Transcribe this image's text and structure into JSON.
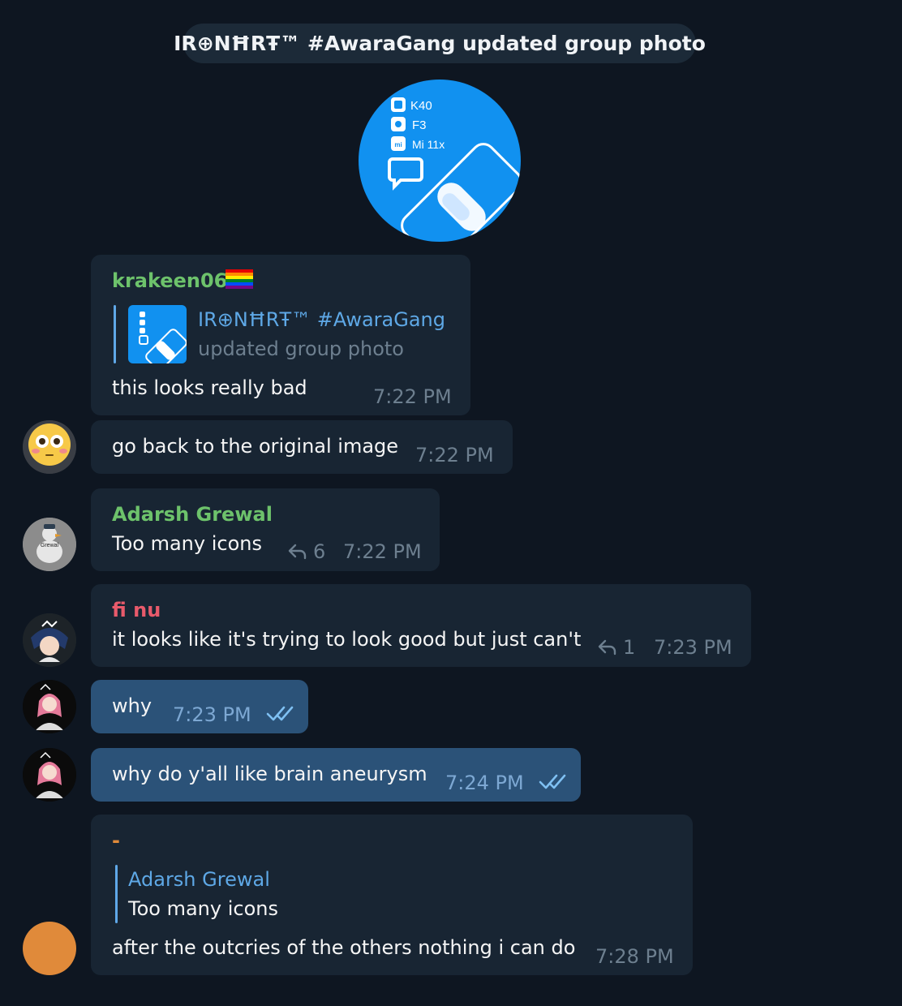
{
  "colors": {
    "background": "#0e1621",
    "bubble_in": "#182533",
    "bubble_out": "#2b5278",
    "accent_blue": "#1191f0",
    "name_green": "#6dc26b",
    "name_red": "#e85a6b",
    "name_orange": "#e08a3a",
    "reply_blue": "#5ea8e6",
    "meta_gray": "#6d7f8f"
  },
  "service_message": "IR⊕NĦRŦ™ #AwaraGang updated group photo",
  "group_photo": {
    "labels": [
      "K40",
      "F3",
      "Mi 11x"
    ],
    "icon": "chat-bubble-icon"
  },
  "messages": [
    {
      "sender": "krakeen06",
      "sender_flag": "🏳️‍🌈",
      "reply_to": {
        "name": "IR⊕NĦRŦ™ #AwaraGang",
        "text": "updated group photo"
      },
      "text": "this looks really bad",
      "time": "7:22 PM"
    },
    {
      "text": "go back to the original image",
      "time": "7:22 PM",
      "avatar": "flushed-emoji-avatar"
    },
    {
      "sender": "Adarsh Grewal",
      "text": "Too many icons",
      "replies": "6",
      "time": "7:22 PM",
      "avatar": "goose-avatar"
    },
    {
      "sender": "fi nu",
      "text": "it looks like it's trying to look good but just can't",
      "replies": "1",
      "time": "7:23 PM",
      "avatar": "anime-avatar"
    },
    {
      "text": "why",
      "time": "7:23 PM",
      "status": "read",
      "avatar": "pink-hair-avatar"
    },
    {
      "text": "why do y'all like brain aneurysm",
      "time": "7:24 PM",
      "status": "read",
      "avatar": "pink-hair-avatar"
    },
    {
      "sender": "-",
      "reply_to": {
        "name": "Adarsh Grewal",
        "text": "Too many icons"
      },
      "text": "after the outcries of the others nothing i can do",
      "time": "7:28 PM",
      "avatar": "orange-circle-avatar"
    }
  ]
}
